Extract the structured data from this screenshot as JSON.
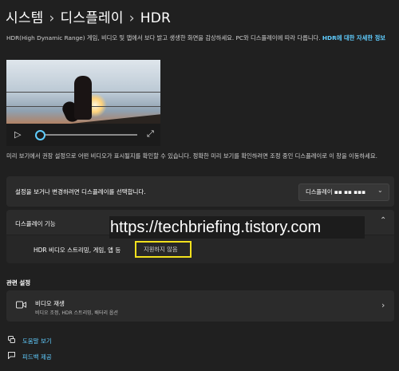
{
  "breadcrumb": {
    "part1": "시스템",
    "sep": "›",
    "part2": "디스플레이",
    "part3": "HDR"
  },
  "intro": {
    "text": "HDR(High Dynamic Range) 게임, 비디오 및 앱에서 보다 밝고 생생한 화면을 감상하세요. PC와 디스플레이에 따라 다릅니다. ",
    "link": "HDR에 대한 자세한 정보"
  },
  "player": {
    "play_icon": "▷",
    "expand_icon": "⤢",
    "progress": 0
  },
  "preview_desc": "미리 보기에서 권장 설정으로 어떤 비디오가 표시될지를 확인할 수 있습니다. 정확한 미리 보기를 확인하려면 조정 중인 디스플레이로 이 창을 이동하세요.",
  "display_select": {
    "label": "설정을 보거나 변경하려면 디스플레이를 선택합니다.",
    "value": "디스플레이 ▪▪ ▪▪ ▪▪▪",
    "chevron": "⌄"
  },
  "capabilities": {
    "label": "디스플레이 기능",
    "chevron": "⌃",
    "row_label": "HDR 비디오 스트리밍, 게임, 앱 등",
    "status": "지원하지 않음"
  },
  "watermark": "https://techbriefing.tistory.com",
  "related": {
    "title": "관련 설정",
    "item_title": "비디오 재생",
    "item_sub": "비디오 조정, HDR 스트리밍, 배터리 옵션",
    "item_icon": "video-icon",
    "chevron": "›"
  },
  "links": {
    "help": "도움말 보기",
    "feedback": "피드백 제공"
  }
}
